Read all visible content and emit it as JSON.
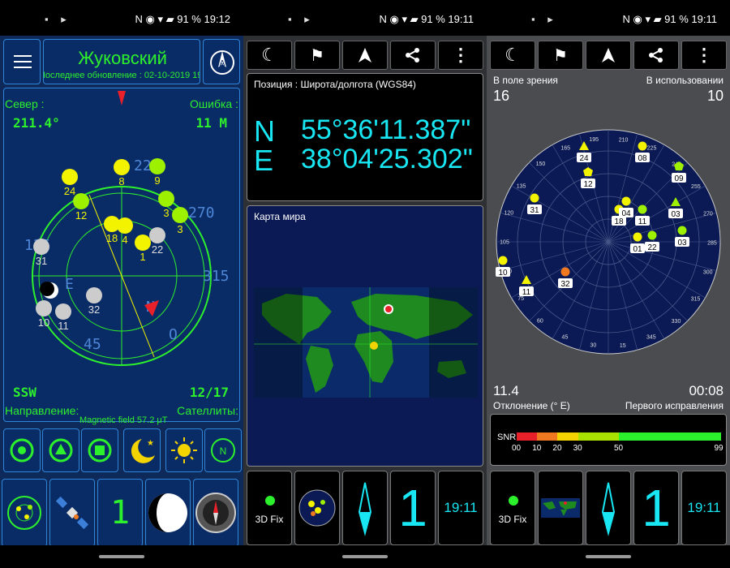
{
  "status_bar": {
    "left_icons": "▪ ▸",
    "panel1_right": "N ◉ ▾ ▰ 91 % 19:12",
    "panel2_right": "N ◉ ▾ ▰ 91 % 19:11",
    "panel3_right": "N ◉ ▾ ▰ 91 % 19:11"
  },
  "panel1": {
    "city": "Жуковский",
    "last_update": "Последнее обновление : 02-10-2019 19:12",
    "north_label": "Север :",
    "north_value": "211.4°",
    "error_label": "Ошибка :",
    "error_value": "11 M",
    "direction_value": "SSW",
    "satellites_value": "12/17",
    "direction_label": "Направление:",
    "satellites_label": "Сателлиты:",
    "magnetic": "Magnetic field 57.2 μT",
    "compass_ticks": [
      "225",
      "270",
      "315",
      "45",
      "135",
      "E",
      "N",
      "O"
    ],
    "sats": [
      {
        "id": "8",
        "c": "#f3f300"
      },
      {
        "id": "9",
        "c": "#9cf000"
      },
      {
        "id": "24",
        "c": "#f3f300"
      },
      {
        "id": "12",
        "c": "#9cf000"
      },
      {
        "id": "3",
        "c": "#9cf000"
      },
      {
        "id": "3",
        "c": "#9cf000"
      },
      {
        "id": "18",
        "c": "#f3f300"
      },
      {
        "id": "4",
        "c": "#f3f300"
      },
      {
        "id": "22",
        "c": "#cccccc"
      },
      {
        "id": "1",
        "c": "#f3f300"
      },
      {
        "id": "31",
        "c": "#cccccc"
      },
      {
        "id": "32",
        "c": "#cccccc"
      },
      {
        "id": "10",
        "c": "#cccccc"
      },
      {
        "id": "11",
        "c": "#cccccc"
      }
    ],
    "bottom_glyph": "1"
  },
  "panel2": {
    "position_title": "Позиция : Широта/долгота (WGS84)",
    "lat_dir": "N",
    "lat": "55°36'11.387\"",
    "lon_dir": "E",
    "lon": "38°04'25.302\"",
    "map_title": "Карта мира",
    "fix": "3D Fix",
    "big_num": "1",
    "time": "19:11"
  },
  "panel3": {
    "in_view_label": "В поле зрения",
    "in_view": "16",
    "in_use_label": "В использовании",
    "in_use": "10",
    "deviation": "11.4",
    "deviation_label": "Отклонение (° E)",
    "first_fix": "00:08",
    "first_fix_label": "Первого исправления",
    "snr_label": "SNR",
    "snr_ticks": [
      "00",
      "10",
      "20",
      "30",
      "50",
      "99"
    ],
    "ring_ticks": [
      "195",
      "210",
      "225",
      "240",
      "255",
      "270",
      "285",
      "300",
      "315",
      "330",
      "345",
      "15",
      "30",
      "45",
      "60",
      "75",
      "90",
      "105",
      "120",
      "135",
      "150",
      "165"
    ],
    "sats": [
      {
        "id": "24",
        "c": "#f3f300",
        "s": "tri"
      },
      {
        "id": "08",
        "c": "#f3f300",
        "s": "dot"
      },
      {
        "id": "12",
        "c": "#f3f300",
        "s": "pent"
      },
      {
        "id": "09",
        "c": "#9cf000",
        "s": "pent"
      },
      {
        "id": "31",
        "c": "#f3f300",
        "s": "dot"
      },
      {
        "id": "18",
        "c": "#f3f300",
        "s": "dot"
      },
      {
        "id": "04",
        "c": "#f3f300",
        "s": "dot"
      },
      {
        "id": "11",
        "c": "#9cf000",
        "s": "dot"
      },
      {
        "id": "03",
        "c": "#9cf000",
        "s": "tri"
      },
      {
        "id": "01",
        "c": "#f3f300",
        "s": "dot"
      },
      {
        "id": "22",
        "c": "#9cf000",
        "s": "dot"
      },
      {
        "id": "03",
        "c": "#9cf000",
        "s": "dot"
      },
      {
        "id": "10",
        "c": "#f3f300",
        "s": "dot"
      },
      {
        "id": "11",
        "c": "#f3f300",
        "s": "tri"
      },
      {
        "id": "32",
        "c": "#f07820",
        "s": "dot"
      }
    ],
    "fix": "3D Fix",
    "big_num": "1",
    "time": "19:11"
  }
}
